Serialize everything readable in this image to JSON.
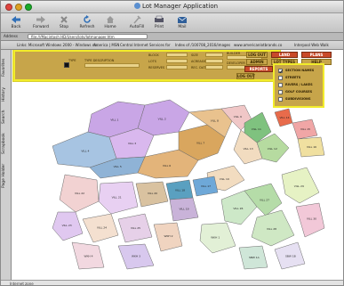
{
  "window": {
    "title": "Lot Manager Application",
    "colors": {
      "close": "#e0443e",
      "minimize": "#dea123",
      "zoom": "#1aab29"
    }
  },
  "toolbar": {
    "buttons": [
      {
        "label": "Back",
        "icon": "back-arrow-icon"
      },
      {
        "label": "Forward",
        "icon": "forward-arrow-icon"
      },
      {
        "label": "Stop",
        "icon": "stop-x-icon"
      },
      {
        "label": "Refresh",
        "icon": "refresh-icon"
      },
      {
        "label": "Home",
        "icon": "home-icon"
      },
      {
        "label": "AutoFill",
        "icon": "autofill-icon"
      },
      {
        "label": "Print",
        "icon": "printer-icon"
      },
      {
        "label": "Mail",
        "icon": "mail-icon"
      }
    ]
  },
  "address": {
    "label": "Address",
    "value": "file:///Macintosh HD/Users/lots/lotmanager.htm"
  },
  "favorites": [
    "Links: Microsoft Windows 2000 - Windows co..",
    "America | MSN",
    "Central Internet Services for",
    "Index of /100708_2016/images",
    "www.americanlotbrands.co",
    "Interpool Web Walk"
  ],
  "sidebar": {
    "tabs": [
      "Favorites",
      "History",
      "Search",
      "Scrapbook",
      "Page Holder"
    ]
  },
  "controls": {
    "type_label": "TYPE",
    "type_description_label": "TYPE DESCRIPTION",
    "block_label": "BLOCK",
    "lots_label": "LOTS",
    "reserves_label": "RESERVES",
    "size_label": "SIZE",
    "acreage_label": "ACREAGE",
    "rec_date_label": "REC. DATE",
    "builder_label": "BUILDER",
    "developer_label": "DEVELOPER",
    "log_out": "LOG OUT",
    "admin": "ADMIN",
    "reports": "REPORTS",
    "land": "LAND",
    "lot_types": "LOT TYPES",
    "plans": "PLANS",
    "help": "HELP"
  },
  "legend": {
    "items": [
      {
        "label": "SECTION NAMES",
        "checked": true
      },
      {
        "label": "STREETS",
        "checked": false
      },
      {
        "label": "RIVERS / LAKES",
        "checked": false
      },
      {
        "label": "GOLF COURSES",
        "checked": false
      },
      {
        "label": "SUBDIVISIONS",
        "checked": false
      }
    ]
  },
  "map": {
    "lot_labels": [
      "VILL 1",
      "VILL 2",
      "VILL 3",
      "VILL 4",
      "VILL 5",
      "VILL 6",
      "VILL 7",
      "VILL 8",
      "VILL 9",
      "VILL 10",
      "VILL 11",
      "VILL 12",
      "VILL 13",
      "VILL 14",
      "VILL 15",
      "VILL 16",
      "VILL 17",
      "VILL 18",
      "VILL 19",
      "VILL 20",
      "VILL 21",
      "VILL 22",
      "VILL 23",
      "VILL 24",
      "VILL 25",
      "VILL 26",
      "VILL 27",
      "VILL 28",
      "VILL 29",
      "VILL 30",
      "WKH 1",
      "WKH 2",
      "WKH 3",
      "WKH 4",
      "SBW 1A",
      "SBW 1B",
      "SBW 2A",
      "SBW 2B",
      "SBW 3",
      "SBW 3A",
      "SBW 4A",
      "SBW 4B",
      "SBW 5",
      "SBW 6",
      "SBW 7",
      "SBW 8",
      "SBW 9",
      "SBW 10",
      "SBW 11",
      "SBW 12",
      "SBW 13",
      "SBW 14",
      "SBW 15",
      "SBW 1C"
    ]
  },
  "status": {
    "text": "Internet zone"
  }
}
